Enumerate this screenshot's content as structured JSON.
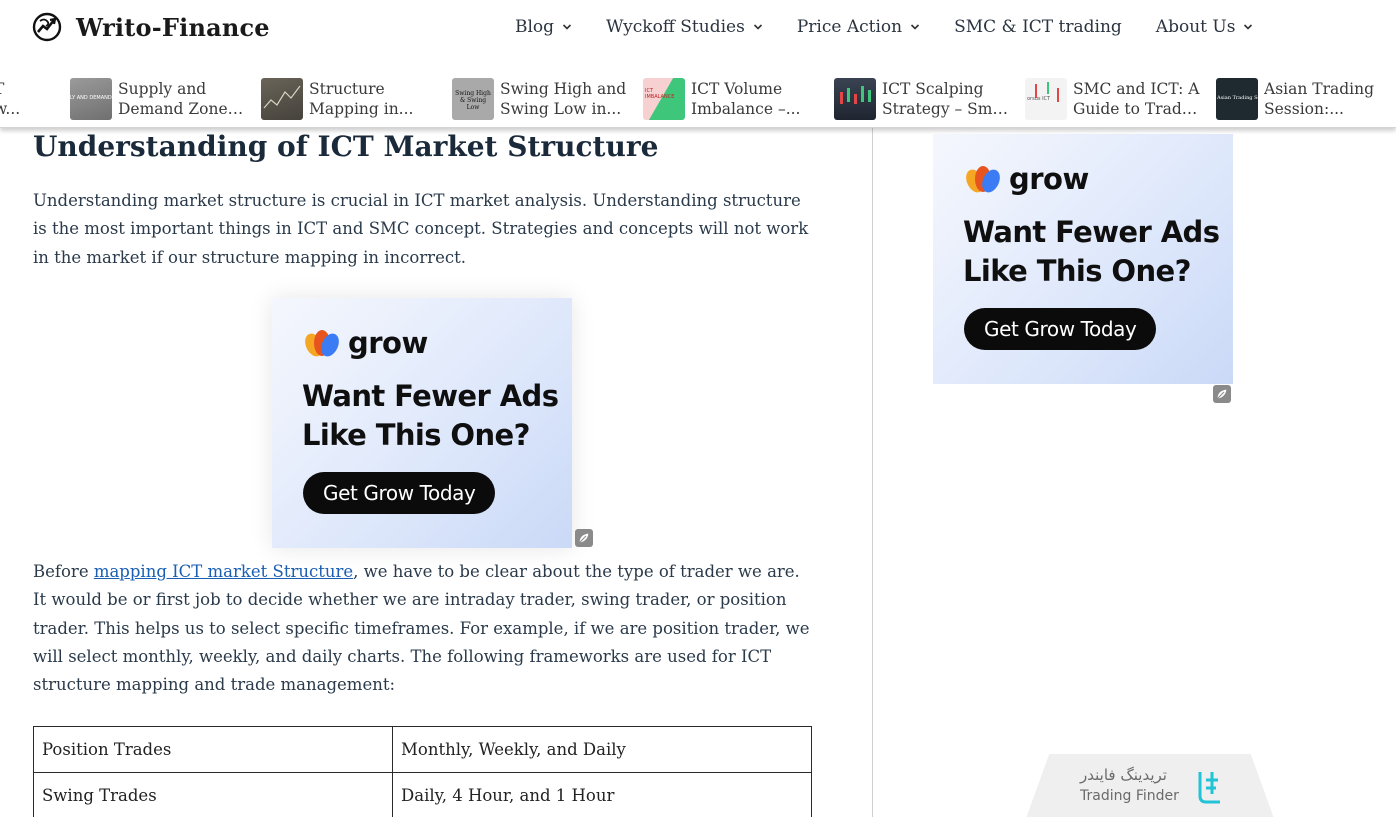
{
  "site": {
    "name": "Writo-Finance"
  },
  "nav": [
    {
      "label": "Blog",
      "has_dropdown": true
    },
    {
      "label": "Wyckoff Studies",
      "has_dropdown": true
    },
    {
      "label": "Price Action",
      "has_dropdown": true
    },
    {
      "label": "SMC & ICT trading",
      "has_dropdown": false
    },
    {
      "label": "About Us",
      "has_dropdown": true
    }
  ],
  "strip": [
    {
      "line1": "T",
      "line2": "w...",
      "thumb_color": "#2a2a2a"
    },
    {
      "line1": "Supply and",
      "line2": "Demand Zones...",
      "thumb_text": "LY AND DEMAND Z",
      "thumb_color": "#8b8b8b"
    },
    {
      "line1": "Structure",
      "line2": "Mapping in...",
      "thumb_color": "#5b574e"
    },
    {
      "line1": "Swing High and",
      "line2": "Swing Low in...",
      "thumb_text": "Swing High & Swing Low",
      "thumb_color": "#a7a7a7"
    },
    {
      "line1": "ICT Volume",
      "line2": "Imbalance –...",
      "thumb_text": "ICT IMBALANCE",
      "thumb_color": "#f4c6c6"
    },
    {
      "line1": "ICT Scalping",
      "line2": "Strategy – Sma...",
      "thumb_color": "#2d3440"
    },
    {
      "line1": "SMC and ICT: A",
      "line2": "Guide to Trade...",
      "thumb_text": "orsus ICT",
      "thumb_color": "#f2f2f2"
    },
    {
      "line1": "Asian Trading",
      "line2": "Session:...",
      "thumb_text": "Asian Trading Session",
      "thumb_color": "#1e2a30"
    }
  ],
  "article": {
    "heading": "Understanding of ICT Market Structure",
    "para1": "Understanding market structure is crucial in ICT market analysis. Understanding structure is the most important things in ICT and SMC concept. Strategies and concepts will not work in the market if our structure mapping in incorrect.",
    "para2_before": "Before ",
    "para2_link": "mapping ICT market Structure",
    "para2_after": ", we have to be clear about the type of trader we are. It would be or first job to decide whether we are intraday trader, swing trader, or position trader. This helps us to select specific timeframes. For example, if we are position trader, we will select monthly, weekly, and daily charts. The following frameworks are used for ICT structure mapping and trade management:",
    "table": [
      [
        "Position Trades",
        "Monthly, Weekly, and Daily"
      ],
      [
        "Swing Trades",
        "Daily, 4 Hour, and 1 Hour"
      ]
    ]
  },
  "ad": {
    "brand": "grow",
    "headline_line1": "Want Fewer Ads",
    "headline_line2": "Like This One?",
    "cta": "Get Grow Today"
  },
  "widget": {
    "name_fa": "تریدینگ فایندر",
    "name_en": "Trading Finder"
  },
  "colors": {
    "link": "#1a5fb4",
    "ad_cta_bg": "#0b0b0b",
    "widget_logo": "#22c3d6"
  }
}
